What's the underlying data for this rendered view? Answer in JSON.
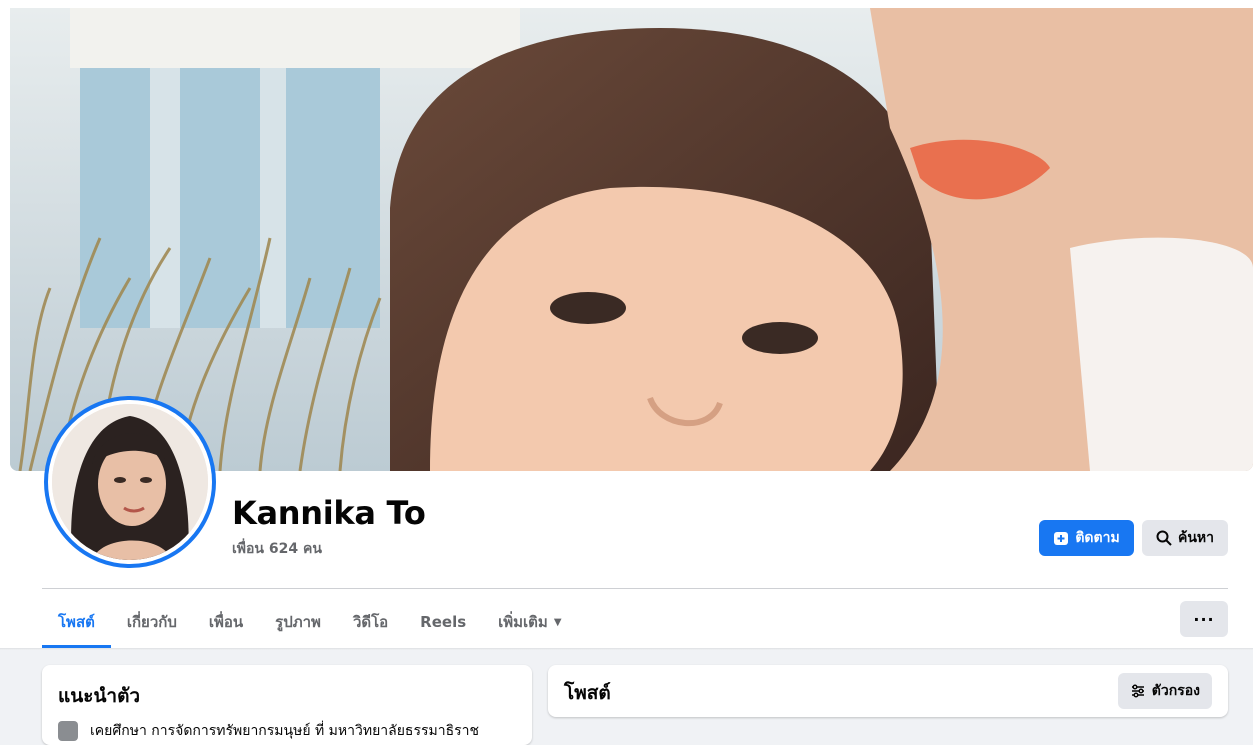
{
  "profile": {
    "name": "Kannika To",
    "friends": "เพื่อน 624 คน"
  },
  "actions": {
    "follow_label": "ติดตาม",
    "search_label": "ค้นหา",
    "more_label": "···"
  },
  "tabs": [
    {
      "label": "โพสต์",
      "active": true
    },
    {
      "label": "เกี่ยวกับ",
      "active": false
    },
    {
      "label": "เพื่อน",
      "active": false
    },
    {
      "label": "รูปภาพ",
      "active": false
    },
    {
      "label": "วิดีโอ",
      "active": false
    },
    {
      "label": "Reels",
      "active": false
    },
    {
      "label": "เพิ่มเติม",
      "active": false
    }
  ],
  "intro": {
    "title": "แนะนำตัว",
    "line": "เคยศึกษา การจัดการทรัพยากรมนุษย์ ที่ มหาวิทยาลัยธรรมาธิราช"
  },
  "posts": {
    "title": "โพสต์",
    "filter_label": "ตัวกรอง"
  },
  "colors": {
    "accent": "#1877f2",
    "background": "#f0f2f5",
    "secondary_button": "#e4e6eb",
    "muted_text": "#65676b"
  },
  "icons": {
    "follow": "add-friend-icon",
    "search": "search-icon",
    "more": "more-icon",
    "filter": "filter-icon",
    "dropdown": "caret-down-icon"
  }
}
